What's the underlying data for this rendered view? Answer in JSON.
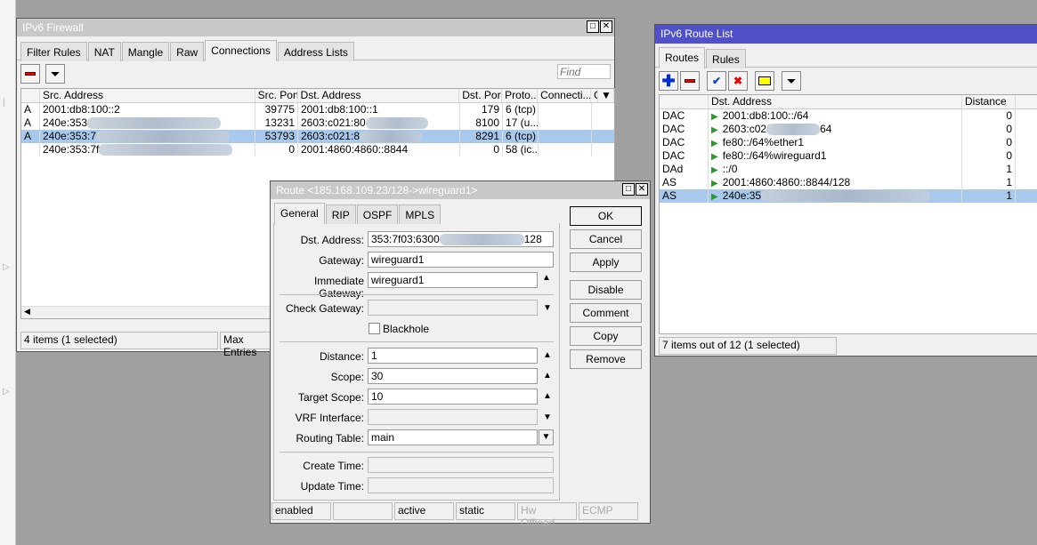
{
  "firewall": {
    "title": "IPv6 Firewall",
    "tabs": [
      "Filter Rules",
      "NAT",
      "Mangle",
      "Raw",
      "Connections",
      "Address Lists"
    ],
    "selected_tab": "Connections",
    "find_placeholder": "Find",
    "columns": [
      "",
      "Src. Address",
      "Src. Port",
      "Dst. Address",
      "Dst. Port",
      "Proto...",
      "Connecti...",
      "C"
    ],
    "rows": [
      {
        "flag": "A",
        "src": "2001:db8:100::2",
        "sport": "39775",
        "dst": "2001:db8:100::1",
        "dport": "179",
        "proto": "6 (tcp)"
      },
      {
        "flag": "A",
        "src": "240e:353",
        "sport": "13231",
        "dst": "2603:c021:80",
        "dport": "8100",
        "proto": "17 (u..."
      },
      {
        "flag": "A",
        "src": "240e:353:7",
        "sport": "53793",
        "dst": "2603:c021:8",
        "dport": "8291",
        "proto": "6 (tcp)",
        "selected": true
      },
      {
        "flag": "",
        "src": "240e:353:7f",
        "sport": "0",
        "dst": "2001:4860:4860::8844",
        "dport": "0",
        "proto": "58 (ic..."
      }
    ],
    "status": "4 items (1 selected)",
    "max_entries": "Max Entries"
  },
  "routelist": {
    "title": "IPv6 Route List",
    "tabs": [
      "Routes",
      "Rules"
    ],
    "selected_tab": "Routes",
    "columns": [
      "",
      "Dst. Address",
      "Distance"
    ],
    "rows": [
      {
        "flag": "DAC",
        "dst": "2001:db8:100::/64",
        "dist": "0"
      },
      {
        "flag": "DAC",
        "dst": "2603:c02",
        "dst_tail": "64",
        "dist": "0"
      },
      {
        "flag": "DAC",
        "dst": "fe80::/64%ether1",
        "dist": "0"
      },
      {
        "flag": "DAC",
        "dst": "fe80::/64%wireguard1",
        "dist": "0"
      },
      {
        "flag": "DAd",
        "dst": "::/0",
        "dist": "1"
      },
      {
        "flag": "AS",
        "dst": "2001:4860:4860::8844/128",
        "dist": "1"
      },
      {
        "flag": "AS",
        "dst": "240e:35",
        "dist": "1",
        "selected": true
      }
    ],
    "status": "7 items out of 12 (1 selected)"
  },
  "route": {
    "title": "Route <185.168.109.23/128->wireguard1>",
    "tabs": [
      "General",
      "RIP",
      "OSPF",
      "MPLS"
    ],
    "selected_tab": "General",
    "fields": {
      "dst_label": "Dst. Address:",
      "dst": "353:7f03:6300",
      "dst_tail": "128",
      "gw_label": "Gateway:",
      "gw": "wireguard1",
      "igw_label": "Immediate Gateway:",
      "igw": "wireguard1",
      "check_label": "Check Gateway:",
      "blackhole": "Blackhole",
      "dist_label": "Distance:",
      "dist": "1",
      "scope_label": "Scope:",
      "scope": "30",
      "tscope_label": "Target Scope:",
      "tscope": "10",
      "vrf_label": "VRF Interface:",
      "table_label": "Routing Table:",
      "table": "main",
      "ctime_label": "Create Time:",
      "utime_label": "Update Time:"
    },
    "buttons": [
      "OK",
      "Cancel",
      "Apply",
      "Disable",
      "Comment",
      "Copy",
      "Remove"
    ],
    "status": [
      "enabled",
      "",
      "active",
      "static",
      "Hw Offload...",
      "ECMP"
    ]
  }
}
